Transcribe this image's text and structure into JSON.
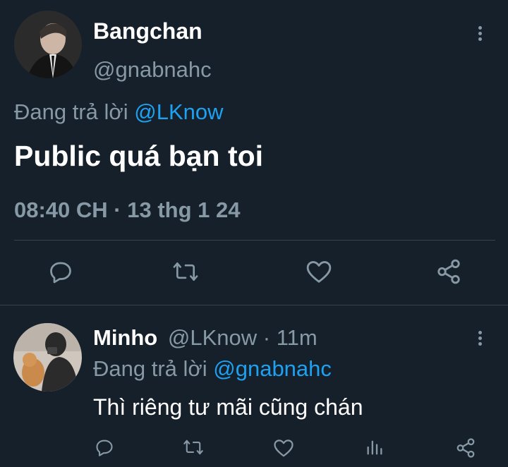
{
  "main_tweet": {
    "display_name": "Bangchan",
    "handle": "@gnabnahc",
    "reply_prefix": "Đang trả lời",
    "reply_to": "@LKnow",
    "text": "Public quá bạn toi",
    "timestamp": "08:40 CH · 13 thg 1 24"
  },
  "reply_tweet": {
    "display_name": "Minho",
    "handle": "@LKnow",
    "separator": "·",
    "time_ago": "11m",
    "reply_prefix": "Đang trả lời",
    "reply_to": "@gnabnahc",
    "text": "Thì riêng tư mãi cũng chán"
  },
  "icons": {
    "reply": "reply-icon",
    "retweet": "retweet-icon",
    "like": "like-icon",
    "share": "share-icon",
    "analytics": "analytics-icon",
    "more": "more-options-icon"
  },
  "colors": {
    "background": "#15202b",
    "muted": "#8899a6",
    "link": "#1da1f2",
    "divider": "#38444d"
  }
}
